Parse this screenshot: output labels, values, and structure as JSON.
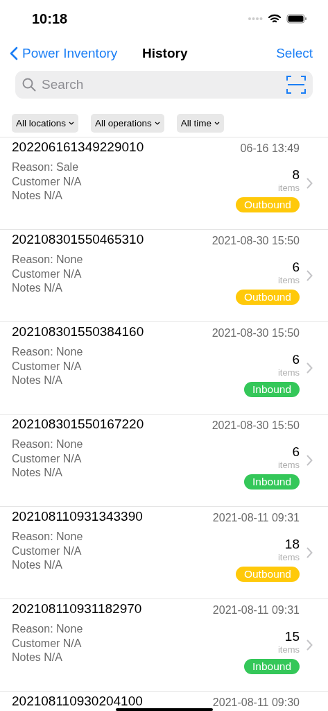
{
  "status_bar": {
    "time": "10:18"
  },
  "nav": {
    "back": "Power Inventory",
    "title": "History",
    "action": "Select"
  },
  "search": {
    "placeholder": "Search"
  },
  "filters": [
    {
      "label": "All locations"
    },
    {
      "label": "All operations"
    },
    {
      "label": "All time"
    }
  ],
  "records": [
    {
      "id": "202206161349229010",
      "date": "06-16 13:49",
      "reason": "Reason: Sale",
      "customer": "Customer N/A",
      "notes": "Notes N/A",
      "count": "8",
      "unit": "items",
      "kind": "outbound",
      "badge": "Outbound"
    },
    {
      "id": "202108301550465310",
      "date": "2021-08-30 15:50",
      "reason": "Reason: None",
      "customer": "Customer N/A",
      "notes": "Notes N/A",
      "count": "6",
      "unit": "items",
      "kind": "outbound",
      "badge": "Outbound"
    },
    {
      "id": "202108301550384160",
      "date": "2021-08-30 15:50",
      "reason": "Reason: None",
      "customer": "Customer N/A",
      "notes": "Notes N/A",
      "count": "6",
      "unit": "items",
      "kind": "inbound",
      "badge": "Inbound"
    },
    {
      "id": "202108301550167220",
      "date": "2021-08-30 15:50",
      "reason": "Reason: None",
      "customer": "Customer N/A",
      "notes": "Notes N/A",
      "count": "6",
      "unit": "items",
      "kind": "inbound",
      "badge": "Inbound"
    },
    {
      "id": "202108110931343390",
      "date": "2021-08-11 09:31",
      "reason": "Reason: None",
      "customer": "Customer N/A",
      "notes": "Notes N/A",
      "count": "18",
      "unit": "items",
      "kind": "outbound",
      "badge": "Outbound"
    },
    {
      "id": "202108110931182970",
      "date": "2021-08-11 09:31",
      "reason": "Reason: None",
      "customer": "Customer N/A",
      "notes": "Notes N/A",
      "count": "15",
      "unit": "items",
      "kind": "inbound",
      "badge": "Inbound"
    },
    {
      "id": "202108110930204100",
      "date": "2021-08-11 09:30"
    }
  ]
}
